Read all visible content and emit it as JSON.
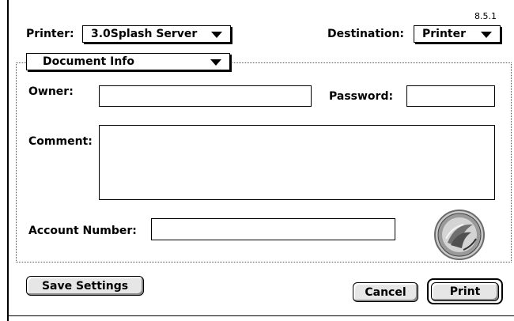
{
  "version": "8.5.1",
  "printer": {
    "label": "Printer:",
    "value": "3.0Splash Server"
  },
  "destination": {
    "label": "Destination:",
    "value": "Printer"
  },
  "panel": {
    "selected": "Document Info"
  },
  "form": {
    "owner_label": "Owner:",
    "owner_value": "",
    "password_label": "Password:",
    "password_value": "",
    "comment_label": "Comment:",
    "comment_value": "",
    "account_label": "Account Number:",
    "account_value": ""
  },
  "buttons": {
    "save_settings": "Save Settings",
    "cancel": "Cancel",
    "print": "Print"
  },
  "icons": {
    "logo": "splash-logo-icon",
    "dropdown": "chevron-down-icon"
  }
}
